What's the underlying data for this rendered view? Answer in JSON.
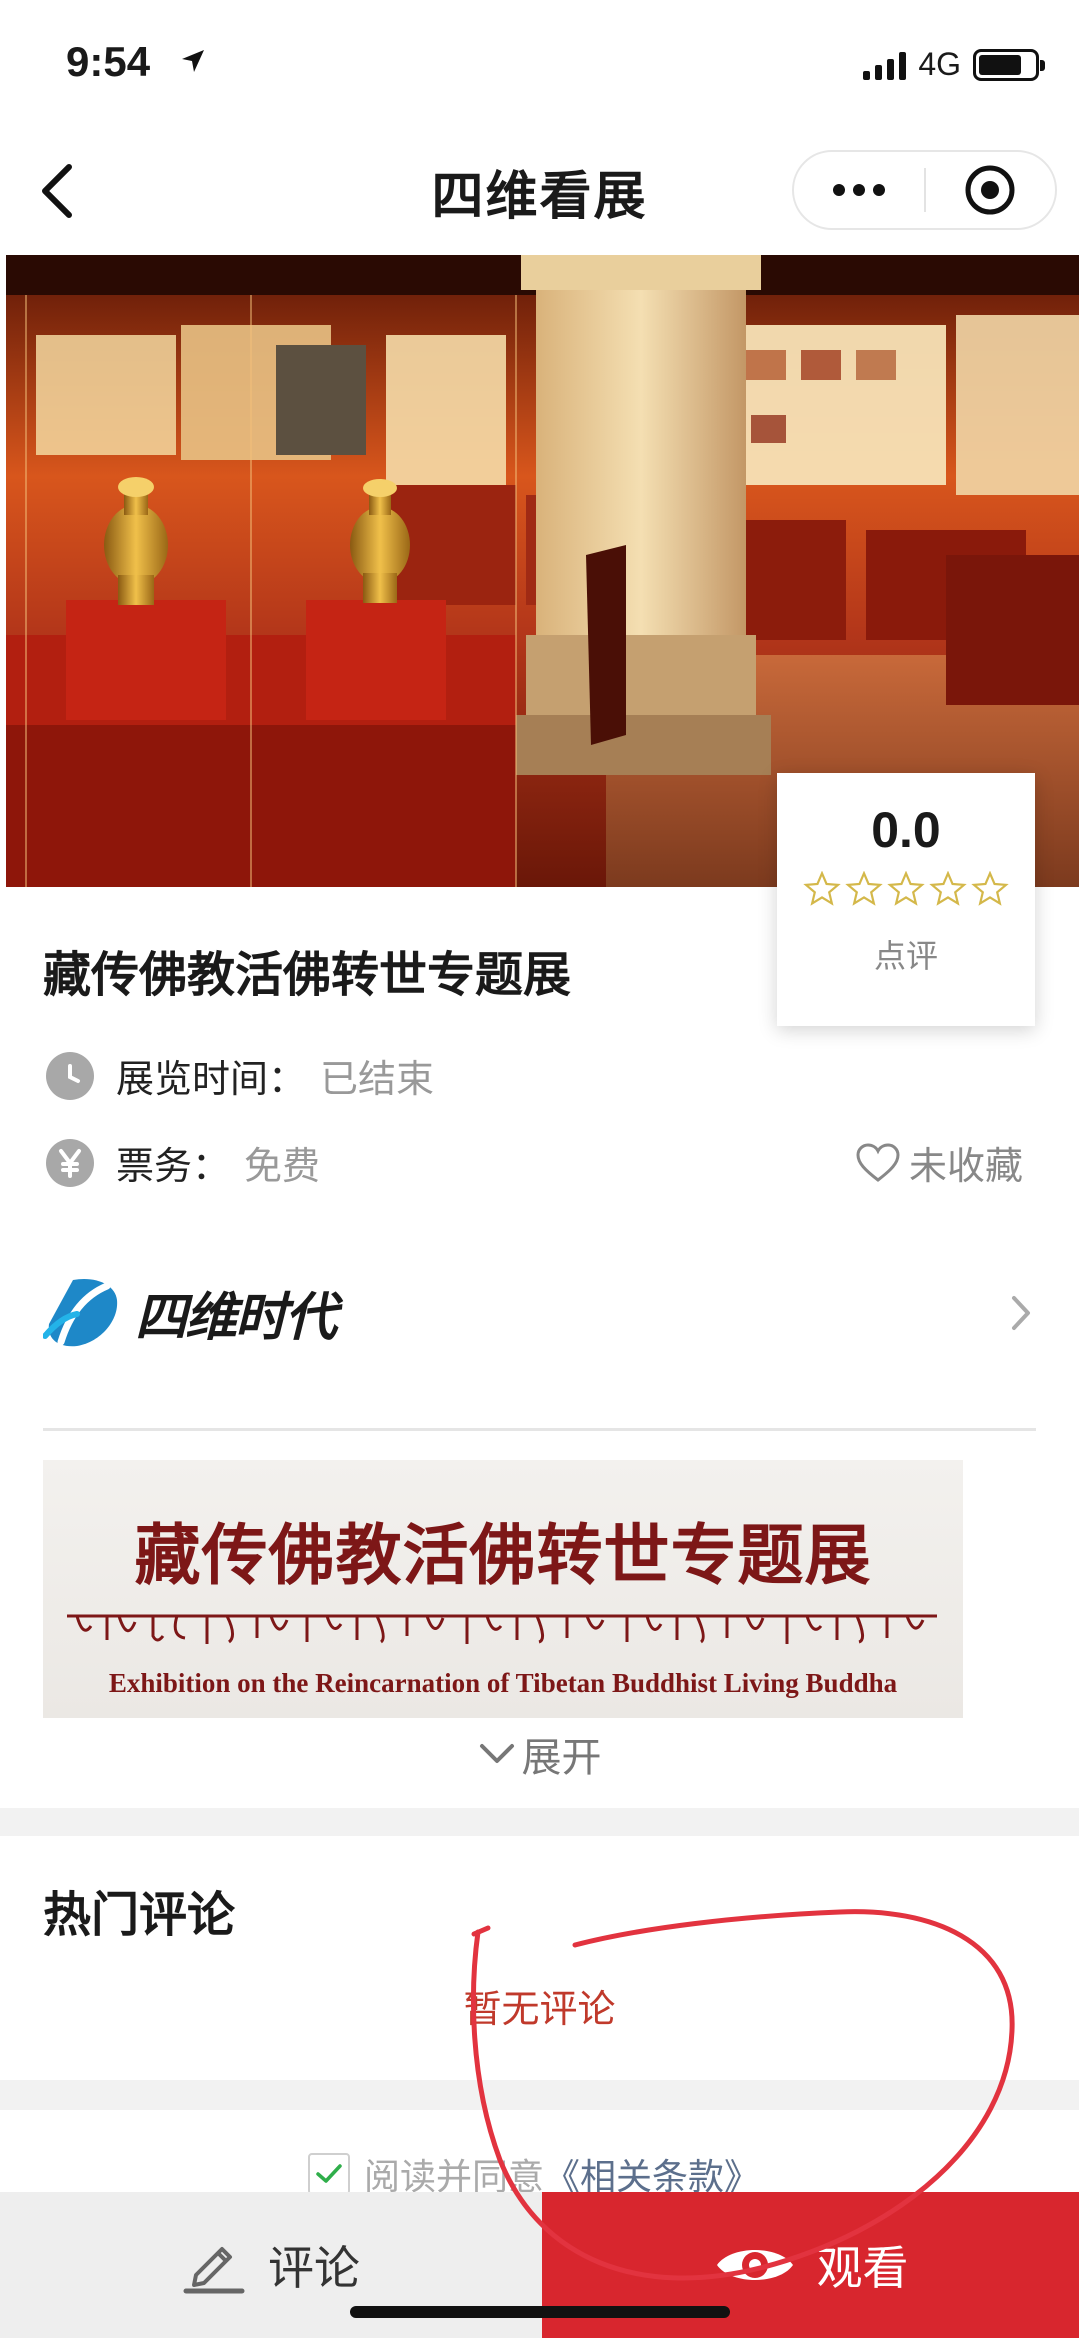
{
  "status_bar": {
    "time": "9:54",
    "network": "4G"
  },
  "nav": {
    "title": "四维看展"
  },
  "rating": {
    "score": "0.0",
    "stars_filled": 0,
    "stars_total": 5,
    "label": "点评"
  },
  "exhibition": {
    "title": "藏传佛教活佛转世专题展",
    "time_label": "展览时间：",
    "time_value": "已结束",
    "ticket_label": "票务：",
    "ticket_value": "免费",
    "favorite_label": "未收藏"
  },
  "organizer": {
    "name": "四维时代"
  },
  "banner": {
    "title": "藏传佛教活佛转世专题展",
    "subtitle_en": "Exhibition on the Reincarnation of Tibetan Buddhist Living Buddha"
  },
  "expand_label": "展开",
  "comments": {
    "title": "热门评论",
    "empty_text": "暂无评论"
  },
  "agreement": {
    "text": "阅读并同意",
    "link": "《相关条款》",
    "checked": true
  },
  "bottom_bar": {
    "comment_label": "评论",
    "watch_label": "观看"
  },
  "colors": {
    "accent_red": "#d8262e",
    "empty_text_red": "#c0392b",
    "link_blue": "#5c6f8c",
    "banner_text": "#7d1717"
  }
}
